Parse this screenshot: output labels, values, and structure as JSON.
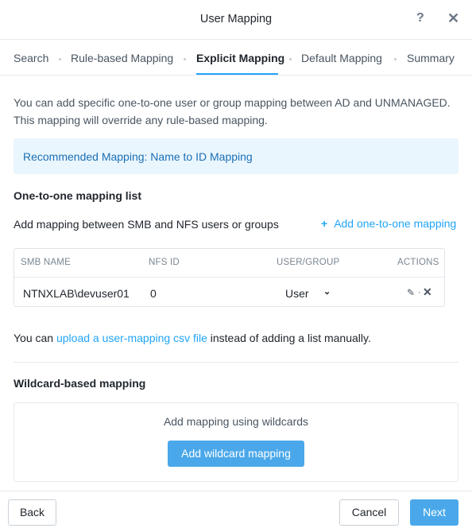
{
  "dialog": {
    "title": "User Mapping",
    "help_icon": "?",
    "close_icon": "✕"
  },
  "tabs": [
    {
      "label": "Search",
      "active": false
    },
    {
      "label": "Rule-based Mapping",
      "active": false
    },
    {
      "label": "Explicit Mapping",
      "active": true
    },
    {
      "label": "Default Mapping",
      "active": false
    },
    {
      "label": "Summary",
      "active": false
    }
  ],
  "intro": {
    "line1": "You can add specific one-to-one user or group mapping between AD and UNMANAGED.",
    "line2": "This mapping will override any rule-based mapping."
  },
  "recommendation": "Recommended Mapping: Name to ID Mapping",
  "one_to_one": {
    "title": "One-to-one mapping list",
    "description": "Add mapping between SMB and NFS users or groups",
    "add_link": "Add one-to-one mapping",
    "add_link_icon": "+",
    "columns": [
      "SMB NAME",
      "NFS ID",
      "USER/GROUP",
      "ACTIONS"
    ],
    "rows": [
      {
        "smb_name": "NTNXLAB\\devuser01",
        "nfs_id": "0",
        "user_group": "User"
      }
    ],
    "action_icons": [
      "pencil-icon",
      "close-icon"
    ]
  },
  "upload": {
    "prefix": "You can ",
    "link": "upload a user-mapping csv file",
    "suffix": " instead of adding a list manually."
  },
  "wildcard": {
    "title": "Wildcard-based mapping",
    "hint": "Add mapping using wildcards",
    "button": "Add wildcard mapping"
  },
  "footer": {
    "back": "Back",
    "cancel": "Cancel",
    "next": "Next"
  },
  "colors": {
    "accent": "#22a5f7",
    "primary_button": "#4aa8ea",
    "info_background": "#eaf6fe"
  }
}
